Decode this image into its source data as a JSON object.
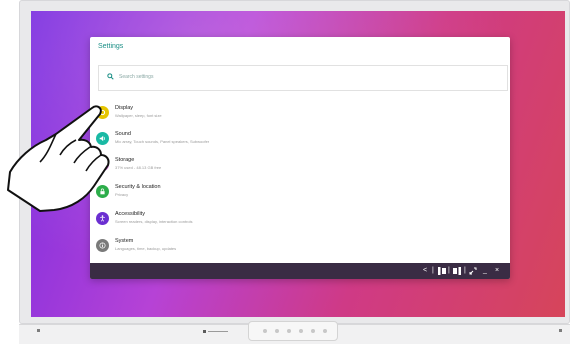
{
  "settings": {
    "title": "Settings",
    "search_placeholder": "Search settings",
    "items": [
      {
        "title": "Display",
        "subtitle": "Wallpaper, sleep, font size",
        "icon": "display-icon",
        "color": "#e6c500"
      },
      {
        "title": "Sound",
        "subtitle": "Mic array, Touch sounds, Panel speakers, Subwoofer",
        "icon": "sound-icon",
        "color": "#19b9a4"
      },
      {
        "title": "Storage",
        "subtitle": "37% used - 48.13 GB free",
        "icon": "storage-icon",
        "color": "#c257c9"
      },
      {
        "title": "Security & location",
        "subtitle": "Privacy",
        "icon": "lock-icon",
        "color": "#2cad4a"
      },
      {
        "title": "Accessibility",
        "subtitle": "Screen readers, display, interaction controls",
        "icon": "accessibility-icon",
        "color": "#6b2fd1"
      },
      {
        "title": "System",
        "subtitle": "Languages, time, backup, updates",
        "icon": "info-icon",
        "color": "#7a7a7a"
      }
    ]
  },
  "taskbar": {
    "back": "<",
    "divider": "|",
    "minimize": "_",
    "close": "×"
  },
  "colors": {
    "accent": "#1b8f86"
  }
}
